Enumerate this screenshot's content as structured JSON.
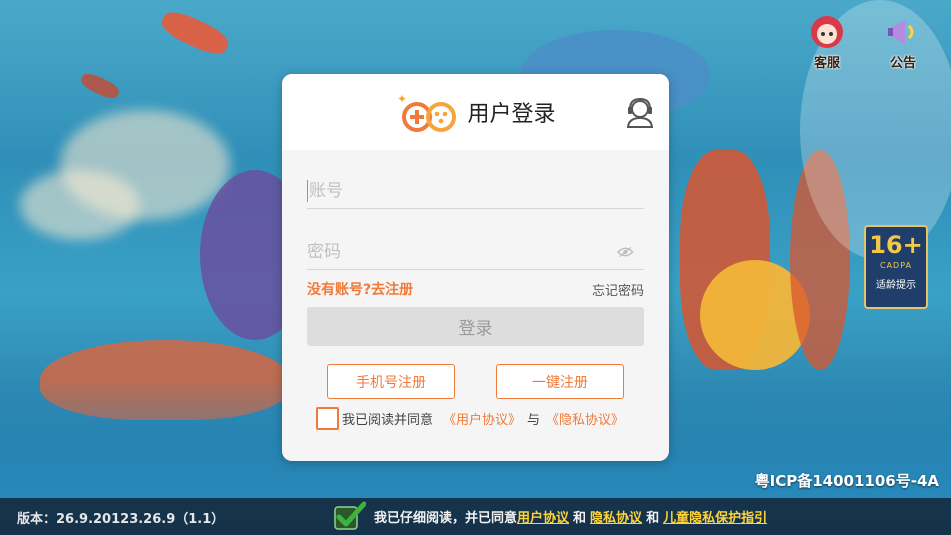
{
  "top_right": {
    "service_label": "客服",
    "notice_label": "公告"
  },
  "age_badge": {
    "rating": "16+",
    "org": "CADPA",
    "hint": "适龄提示"
  },
  "login_card": {
    "title": "用户登录",
    "account_placeholder": "账号",
    "password_placeholder": "密码",
    "register_link": "没有账号?去注册",
    "forgot_link": "忘记密码",
    "login_button": "登录",
    "phone_register_button": "手机号注册",
    "quick_register_button": "一键注册",
    "agreement": {
      "prefix": "我已阅读并同意",
      "user_agreement": "《用户协议》",
      "conjunction": "与",
      "privacy_agreement": "《隐私协议》",
      "checked": false
    }
  },
  "icp": "粤ICP备14001106号-4A",
  "footer": {
    "version": "版本：26.9.20123.26.9（1.1）",
    "consent_prefix": "我已仔细阅读，并已同意",
    "user_agreement": "用户协议",
    "and1": "和",
    "privacy_agreement": "隐私协议",
    "and2": "和",
    "child_privacy": "儿童隐私保护指引",
    "checked": true
  },
  "colors": {
    "accent": "#f07a3a",
    "footer_link": "#ffd43b",
    "footer_check": "#3cb33c"
  }
}
